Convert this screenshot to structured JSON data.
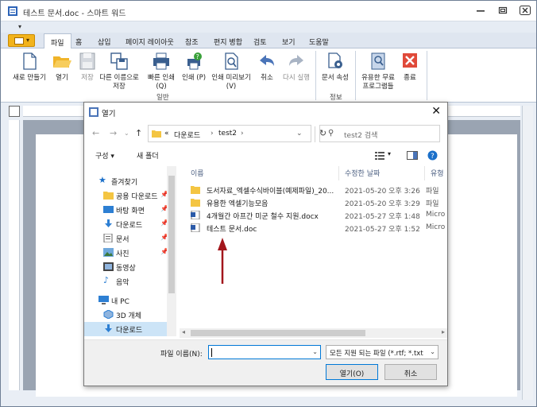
{
  "window": {
    "title": "테스트 문서.doc - 스마트 워드"
  },
  "ribbon": {
    "tabs": [
      "파일",
      "홈",
      "삽입",
      "페이지 레이아웃",
      "참조",
      "편지 병합",
      "검토",
      "보기",
      "도움말"
    ],
    "buttons": {
      "new": "새로 만들기",
      "open": "열기",
      "save": "저장",
      "save_as_1": "다른 이름으로",
      "save_as_2": "저장",
      "quick_print_1": "빠른 인쇄",
      "quick_print_2": "(Q)",
      "print": "인쇄 (P)",
      "print_preview_1": "인쇄 미리보기",
      "print_preview_2": "(V)",
      "undo": "취소",
      "redo": "다시 실행",
      "doc_props": "문서 속성",
      "free_programs_1": "유용한 무료",
      "free_programs_2": "프로그램들",
      "exit": "종료"
    },
    "groups": {
      "general": "일반",
      "info": "정보"
    }
  },
  "dialog": {
    "title": "열기",
    "breadcrumb": {
      "prefix": "«",
      "parts": [
        "다운로드",
        "test2"
      ]
    },
    "search_placeholder": "test2 검색",
    "commands": {
      "organize": "구성 ▾",
      "new_folder": "새 폴더"
    },
    "nav": {
      "items": [
        {
          "label": "즐겨찾기",
          "icon": "star-icon"
        },
        {
          "label": "공용 다운로드",
          "icon": "folder-icon"
        },
        {
          "label": "바탕 화면",
          "icon": "desktop-icon"
        },
        {
          "label": "다운로드",
          "icon": "download-icon"
        },
        {
          "label": "문서",
          "icon": "document-icon"
        },
        {
          "label": "사진",
          "icon": "picture-icon"
        },
        {
          "label": "동영상",
          "icon": "video-icon"
        },
        {
          "label": "음악",
          "icon": "music-icon"
        },
        {
          "label": "내 PC",
          "icon": "pc-icon"
        },
        {
          "label": "3D 개체",
          "icon": "cube-icon"
        },
        {
          "label": "다운로드",
          "icon": "download-icon"
        }
      ]
    },
    "columns": {
      "name": "이름",
      "modified": "수정한 날짜",
      "type": "유형"
    },
    "files": [
      {
        "name": "도서자료_엑셀수식바이블(예제파일)_20...",
        "date": "2021-05-20 오후 3:26",
        "type": "파일",
        "icon": "folder-icon"
      },
      {
        "name": "유용한 엑셀기능모음",
        "date": "2021-05-20 오후 3:29",
        "type": "파일",
        "icon": "folder-icon"
      },
      {
        "name": "4개월간 아프간 미군 철수 지원.docx",
        "date": "2021-05-27 오후 1:48",
        "type": "Micro",
        "icon": "word-doc-icon"
      },
      {
        "name": "테스트 문서.doc",
        "date": "2021-05-27 오후 1:52",
        "type": "Micro",
        "icon": "word-doc-icon"
      }
    ],
    "filename_label": "파일 이름(N):",
    "filename_value": "",
    "filetype_value": "모든 지원 되는 파일 (*.rtf; *.txt",
    "open_button": "열기(O)",
    "cancel_button": "취소"
  },
  "colors": {
    "accent": "#0078d7",
    "folder": "#f4c542",
    "arrow": "#a3161c"
  }
}
